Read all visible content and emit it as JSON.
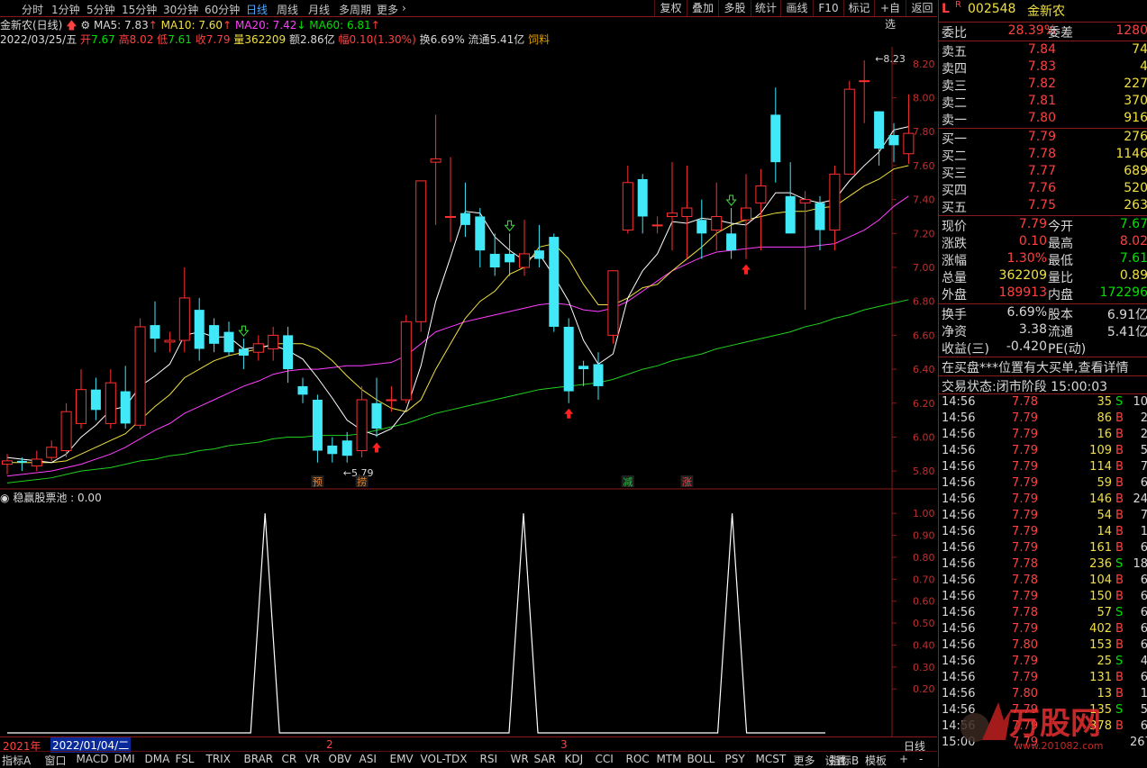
{
  "topbar": {
    "tabs": [
      "分时",
      "1分钟",
      "5分钟",
      "15分钟",
      "30分钟",
      "60分钟",
      "日线",
      "周线",
      "月线",
      "多周期",
      "更多"
    ],
    "active_tab": "日线",
    "right_buttons": [
      "复权",
      "叠加",
      "多股",
      "统计",
      "画线",
      "F10",
      "标记",
      "+自选",
      "返回"
    ]
  },
  "info": {
    "stock_title": "金新农(日线)",
    "ma5": "MA5: 7.83",
    "ma10": "MA10: 7.60",
    "ma20": "MA20: 7.42",
    "ma60": "MA60: 6.81",
    "date": "2022/03/25/五",
    "open_l": "开",
    "open": "7.67",
    "high_l": "高",
    "high": "8.02",
    "low_l": "低",
    "low": "7.61",
    "close_l": "收",
    "close": "7.79",
    "vol_l": "量",
    "vol": "362209",
    "amt_l": "额",
    "amt": "2.86亿",
    "chg_l": "幅",
    "chg": "0.10(1.30%)",
    "turn_l": "换",
    "turn": "6.69%",
    "float_l": "流通",
    "float": "5.41亿",
    "concept": "饲料"
  },
  "chart_data": [
    {
      "type": "candlestick",
      "ylim": [
        5.7,
        8.3
      ],
      "yticks": [
        "8.20",
        "8.00",
        "7.80",
        "7.60",
        "7.40",
        "7.20",
        "7.00",
        "6.80",
        "6.60",
        "6.40",
        "6.20",
        "6.00",
        "5.80"
      ],
      "candles": [
        [
          5.84,
          5.86,
          5.78,
          5.9
        ],
        [
          5.86,
          5.85,
          5.8,
          5.88
        ],
        [
          5.83,
          5.87,
          5.8,
          5.92
        ],
        [
          5.88,
          5.94,
          5.86,
          5.98
        ],
        [
          5.92,
          6.15,
          5.88,
          6.2
        ],
        [
          6.08,
          6.28,
          6.05,
          6.4
        ],
        [
          6.28,
          6.16,
          6.1,
          6.35
        ],
        [
          6.08,
          6.32,
          6.05,
          6.4
        ],
        [
          6.27,
          6.08,
          6.05,
          6.42
        ],
        [
          6.07,
          6.65,
          6.05,
          6.7
        ],
        [
          6.66,
          6.58,
          6.5,
          6.8
        ],
        [
          6.56,
          6.57,
          6.5,
          6.62
        ],
        [
          6.57,
          6.82,
          6.5,
          7.0
        ],
        [
          6.75,
          6.52,
          6.45,
          6.82
        ],
        [
          6.66,
          6.55,
          6.5,
          6.7
        ],
        [
          6.62,
          6.5,
          6.48,
          6.68
        ],
        [
          6.52,
          6.48,
          6.4,
          6.58
        ],
        [
          6.5,
          6.55,
          6.45,
          6.6
        ],
        [
          6.52,
          6.6,
          6.45,
          6.65
        ],
        [
          6.6,
          6.4,
          6.32,
          6.65
        ],
        [
          6.3,
          6.25,
          6.2,
          6.35
        ],
        [
          6.22,
          5.92,
          5.85,
          6.25
        ],
        [
          5.95,
          5.9,
          5.85,
          6.0
        ],
        [
          5.98,
          5.89,
          5.85,
          6.03
        ],
        [
          5.92,
          6.22,
          5.88,
          6.3
        ],
        [
          6.2,
          6.05,
          6.0,
          6.35
        ],
        [
          6.22,
          6.22,
          6.15,
          6.3
        ],
        [
          6.22,
          6.68,
          6.2,
          6.72
        ],
        [
          6.68,
          7.51,
          6.62,
          7.51
        ],
        [
          7.62,
          7.64,
          7.25,
          7.9
        ],
        [
          7.3,
          7.3,
          7.15,
          7.65
        ],
        [
          7.32,
          7.25,
          7.18,
          7.5
        ],
        [
          7.3,
          7.1,
          7.0,
          7.35
        ],
        [
          7.08,
          7.0,
          6.95,
          7.2
        ],
        [
          7.08,
          7.03,
          6.95,
          7.2
        ],
        [
          7.0,
          7.08,
          6.95,
          7.28
        ],
        [
          7.1,
          7.05,
          7.0,
          7.25
        ],
        [
          7.18,
          6.65,
          6.62,
          7.2
        ],
        [
          6.65,
          6.27,
          6.2,
          6.7
        ],
        [
          6.42,
          6.4,
          6.3,
          6.45
        ],
        [
          6.43,
          6.3,
          6.22,
          6.5
        ],
        [
          6.6,
          6.98,
          6.55,
          6.98
        ],
        [
          7.22,
          7.5,
          7.2,
          7.6
        ],
        [
          7.52,
          7.3,
          7.2,
          7.55
        ],
        [
          7.25,
          7.25,
          7.2,
          7.3
        ],
        [
          7.3,
          7.32,
          7.1,
          7.62
        ],
        [
          7.3,
          7.35,
          7.05,
          7.6
        ],
        [
          7.28,
          7.2,
          7.05,
          7.4
        ],
        [
          7.22,
          7.3,
          7.1,
          7.5
        ],
        [
          7.2,
          7.1,
          7.05,
          7.35
        ],
        [
          7.28,
          7.35,
          7.05,
          7.55
        ],
        [
          7.38,
          7.48,
          7.1,
          7.58
        ],
        [
          7.9,
          7.62,
          7.5,
          8.06
        ],
        [
          7.42,
          7.2,
          7.2,
          7.62
        ],
        [
          7.38,
          7.4,
          6.75,
          7.45
        ],
        [
          7.38,
          7.22,
          7.1,
          7.42
        ],
        [
          7.22,
          7.55,
          7.1,
          7.6
        ],
        [
          7.55,
          8.05,
          7.55,
          8.1
        ],
        [
          8.1,
          8.1,
          7.85,
          8.22
        ],
        [
          7.92,
          7.7,
          7.6,
          7.92
        ],
        [
          7.78,
          7.72,
          7.62,
          7.85
        ],
        [
          7.67,
          7.79,
          7.61,
          8.02
        ]
      ],
      "ma5": [
        5.88,
        5.87,
        5.86,
        5.85,
        5.9,
        6.0,
        6.07,
        6.16,
        6.18,
        6.3,
        6.36,
        6.43,
        6.6,
        6.62,
        6.59,
        6.59,
        6.52,
        6.53,
        6.54,
        6.51,
        6.46,
        6.35,
        6.23,
        6.1,
        6.04,
        6.01,
        6.05,
        6.16,
        6.42,
        6.8,
        7.06,
        7.33,
        7.32,
        7.18,
        7.1,
        7.04,
        7.08,
        6.95,
        6.8,
        6.57,
        6.43,
        6.49,
        6.82,
        6.98,
        7.08,
        7.27,
        7.26,
        7.29,
        7.28,
        7.26,
        7.25,
        7.32,
        7.44,
        7.44,
        7.4,
        7.38,
        7.4,
        7.51,
        7.6,
        7.68,
        7.81,
        7.83
      ],
      "ma10": [
        5.85,
        5.85,
        5.85,
        5.85,
        5.86,
        5.9,
        5.94,
        5.98,
        6.02,
        6.1,
        6.18,
        6.25,
        6.35,
        6.4,
        6.45,
        6.48,
        6.5,
        6.52,
        6.55,
        6.55,
        6.55,
        6.52,
        6.45,
        6.36,
        6.28,
        6.22,
        6.17,
        6.15,
        6.22,
        6.4,
        6.55,
        6.7,
        6.8,
        6.86,
        6.96,
        7.0,
        7.12,
        7.14,
        7.05,
        6.9,
        6.78,
        6.78,
        6.82,
        6.88,
        6.9,
        6.98,
        7.05,
        7.12,
        7.2,
        7.25,
        7.28,
        7.3,
        7.32,
        7.33,
        7.33,
        7.35,
        7.36,
        7.42,
        7.48,
        7.52,
        7.58,
        7.6
      ],
      "ma20": [
        5.77,
        5.78,
        5.79,
        5.8,
        5.82,
        5.84,
        5.87,
        5.9,
        5.94,
        5.99,
        6.04,
        6.08,
        6.14,
        6.18,
        6.22,
        6.26,
        6.3,
        6.33,
        6.37,
        6.39,
        6.4,
        6.4,
        6.41,
        6.42,
        6.42,
        6.43,
        6.44,
        6.48,
        6.55,
        6.62,
        6.65,
        6.68,
        6.7,
        6.72,
        6.74,
        6.76,
        6.78,
        6.79,
        6.78,
        6.75,
        6.74,
        6.76,
        6.8,
        6.86,
        6.92,
        6.98,
        7.02,
        7.06,
        7.09,
        7.1,
        7.11,
        7.12,
        7.12,
        7.12,
        7.12,
        7.13,
        7.14,
        7.18,
        7.22,
        7.28,
        7.36,
        7.42
      ],
      "ma60": [
        5.73,
        5.74,
        5.75,
        5.76,
        5.78,
        5.8,
        5.81,
        5.82,
        5.84,
        5.86,
        5.87,
        5.89,
        5.9,
        5.92,
        5.93,
        5.95,
        5.96,
        5.97,
        5.99,
        6.0,
        6.0,
        6.01,
        6.01,
        6.01,
        6.02,
        6.04,
        6.06,
        6.08,
        6.11,
        6.14,
        6.16,
        6.18,
        6.2,
        6.22,
        6.24,
        6.26,
        6.28,
        6.29,
        6.3,
        6.31,
        6.32,
        6.34,
        6.37,
        6.4,
        6.42,
        6.45,
        6.47,
        6.49,
        6.52,
        6.54,
        6.56,
        6.58,
        6.6,
        6.62,
        6.65,
        6.67,
        6.7,
        6.72,
        6.75,
        6.77,
        6.79,
        6.81
      ],
      "annotations": [
        {
          "label": "8.23",
          "value": 8.23,
          "index": 58
        },
        {
          "label": "5.79",
          "value": 5.79,
          "index": 22
        }
      ],
      "signal_marks": [
        {
          "text": "预",
          "index": 21,
          "color": "#e08030"
        },
        {
          "text": "捞",
          "index": 24,
          "color": "#e08030"
        },
        {
          "text": "减",
          "index": 42,
          "color": "#20c040"
        },
        {
          "text": "涨",
          "index": 46,
          "color": "#ff4040"
        }
      ],
      "buy_arrows": [
        25,
        38,
        50
      ],
      "hollow_arrows": [
        16,
        34,
        49
      ],
      "colors": {
        "up": "#ff3030",
        "down": "#40e8f8",
        "ma5": "#ffffff",
        "ma10": "#f0e040",
        "ma20": "#ff40ff",
        "ma60": "#20d020"
      }
    },
    {
      "type": "line",
      "title": "稳赢股票池 : 0.00",
      "ylim": [
        0,
        1.05
      ],
      "yticks": [
        "1.00",
        "0.90",
        "0.80",
        "0.70",
        "0.60",
        "0.50",
        "0.40",
        "0.30",
        "0.20"
      ],
      "peaks_at_index": [
        18,
        35,
        49
      ],
      "values_note": ""
    }
  ],
  "datebar": {
    "year": "2021年",
    "date": "2022/01/04/二",
    "mark2": "2",
    "mark3": "3",
    "period": "日线"
  },
  "indicators": [
    "指标A",
    "窗口",
    "MACD",
    "DMI",
    "DMA",
    "FSL",
    "TRIX",
    "BRAR",
    "CR",
    "VR",
    "OBV",
    "ASI",
    "EMV",
    "VOL-TDX",
    "RSI",
    "WR",
    "SAR",
    "KDJ",
    "CCI",
    "ROC",
    "MTM",
    "BOLL",
    "PSY",
    "MCST",
    "更多",
    "设置"
  ],
  "indicators_right": [
    "指标B",
    "模板",
    "+",
    "-"
  ],
  "quote": {
    "code": "002548",
    "name": "金新农",
    "wb_l": "委比",
    "wb": "28.39%",
    "wc_l": "委差",
    "wc": "1280",
    "asks": [
      [
        "卖五",
        "7.84",
        "74"
      ],
      [
        "卖四",
        "7.83",
        "4"
      ],
      [
        "卖三",
        "7.82",
        "227"
      ],
      [
        "卖二",
        "7.81",
        "370"
      ],
      [
        "卖一",
        "7.80",
        "916"
      ]
    ],
    "bids": [
      [
        "买一",
        "7.79",
        "276"
      ],
      [
        "买二",
        "7.78",
        "1146"
      ],
      [
        "买三",
        "7.77",
        "689"
      ],
      [
        "买四",
        "7.76",
        "520"
      ],
      [
        "买五",
        "7.75",
        "263"
      ]
    ],
    "stats": [
      [
        "现价",
        "7.79",
        "今开",
        "7.67"
      ],
      [
        "涨跌",
        "0.10",
        "最高",
        "8.02"
      ],
      [
        "涨幅",
        "1.30%",
        "最低",
        "7.61"
      ],
      [
        "总量",
        "362209",
        "量比",
        "0.89"
      ],
      [
        "外盘",
        "189913",
        "内盘",
        "172296"
      ]
    ],
    "stats2": [
      [
        "换手",
        "6.69%",
        "股本",
        "6.91亿"
      ],
      [
        "净资",
        "3.38",
        "流通",
        "5.41亿"
      ],
      [
        "收益(三)",
        "-0.420",
        "PE(动)",
        ""
      ]
    ],
    "notice": "在买盘***位置有大买单,查看详情",
    "trade_state": "交易状态:闭市阶段 15:00:03",
    "ticks": [
      [
        "14:56",
        "7.78",
        "35",
        "S",
        "10"
      ],
      [
        "14:56",
        "7.79",
        "86",
        "B",
        "2"
      ],
      [
        "14:56",
        "7.79",
        "16",
        "B",
        "2"
      ],
      [
        "14:56",
        "7.79",
        "109",
        "B",
        "5"
      ],
      [
        "14:56",
        "7.79",
        "114",
        "B",
        "7"
      ],
      [
        "14:56",
        "7.79",
        "59",
        "B",
        "6"
      ],
      [
        "14:56",
        "7.79",
        "146",
        "B",
        "24"
      ],
      [
        "14:56",
        "7.79",
        "54",
        "B",
        "7"
      ],
      [
        "14:56",
        "7.79",
        "14",
        "B",
        "1"
      ],
      [
        "14:56",
        "7.79",
        "161",
        "B",
        "6"
      ],
      [
        "14:56",
        "7.78",
        "236",
        "S",
        "18"
      ],
      [
        "14:56",
        "7.78",
        "104",
        "B",
        "6"
      ],
      [
        "14:56",
        "7.79",
        "150",
        "B",
        "6"
      ],
      [
        "14:56",
        "7.78",
        "57",
        "S",
        "6"
      ],
      [
        "14:56",
        "7.79",
        "402",
        "B",
        "6"
      ],
      [
        "14:56",
        "7.80",
        "153",
        "B",
        "6"
      ],
      [
        "14:56",
        "7.79",
        "25",
        "S",
        "4"
      ],
      [
        "14:56",
        "7.79",
        "131",
        "B",
        "6"
      ],
      [
        "14:56",
        "7.80",
        "13",
        "B",
        "1"
      ],
      [
        "14:56",
        "7.79",
        "135",
        "S",
        "5"
      ],
      [
        "14:56",
        "7.79",
        "378",
        "B",
        "6"
      ],
      [
        "15:00",
        "7.79",
        "",
        "",
        "267"
      ]
    ]
  },
  "watermark": {
    "brand": "万股网",
    "url": "www.201082.com"
  }
}
